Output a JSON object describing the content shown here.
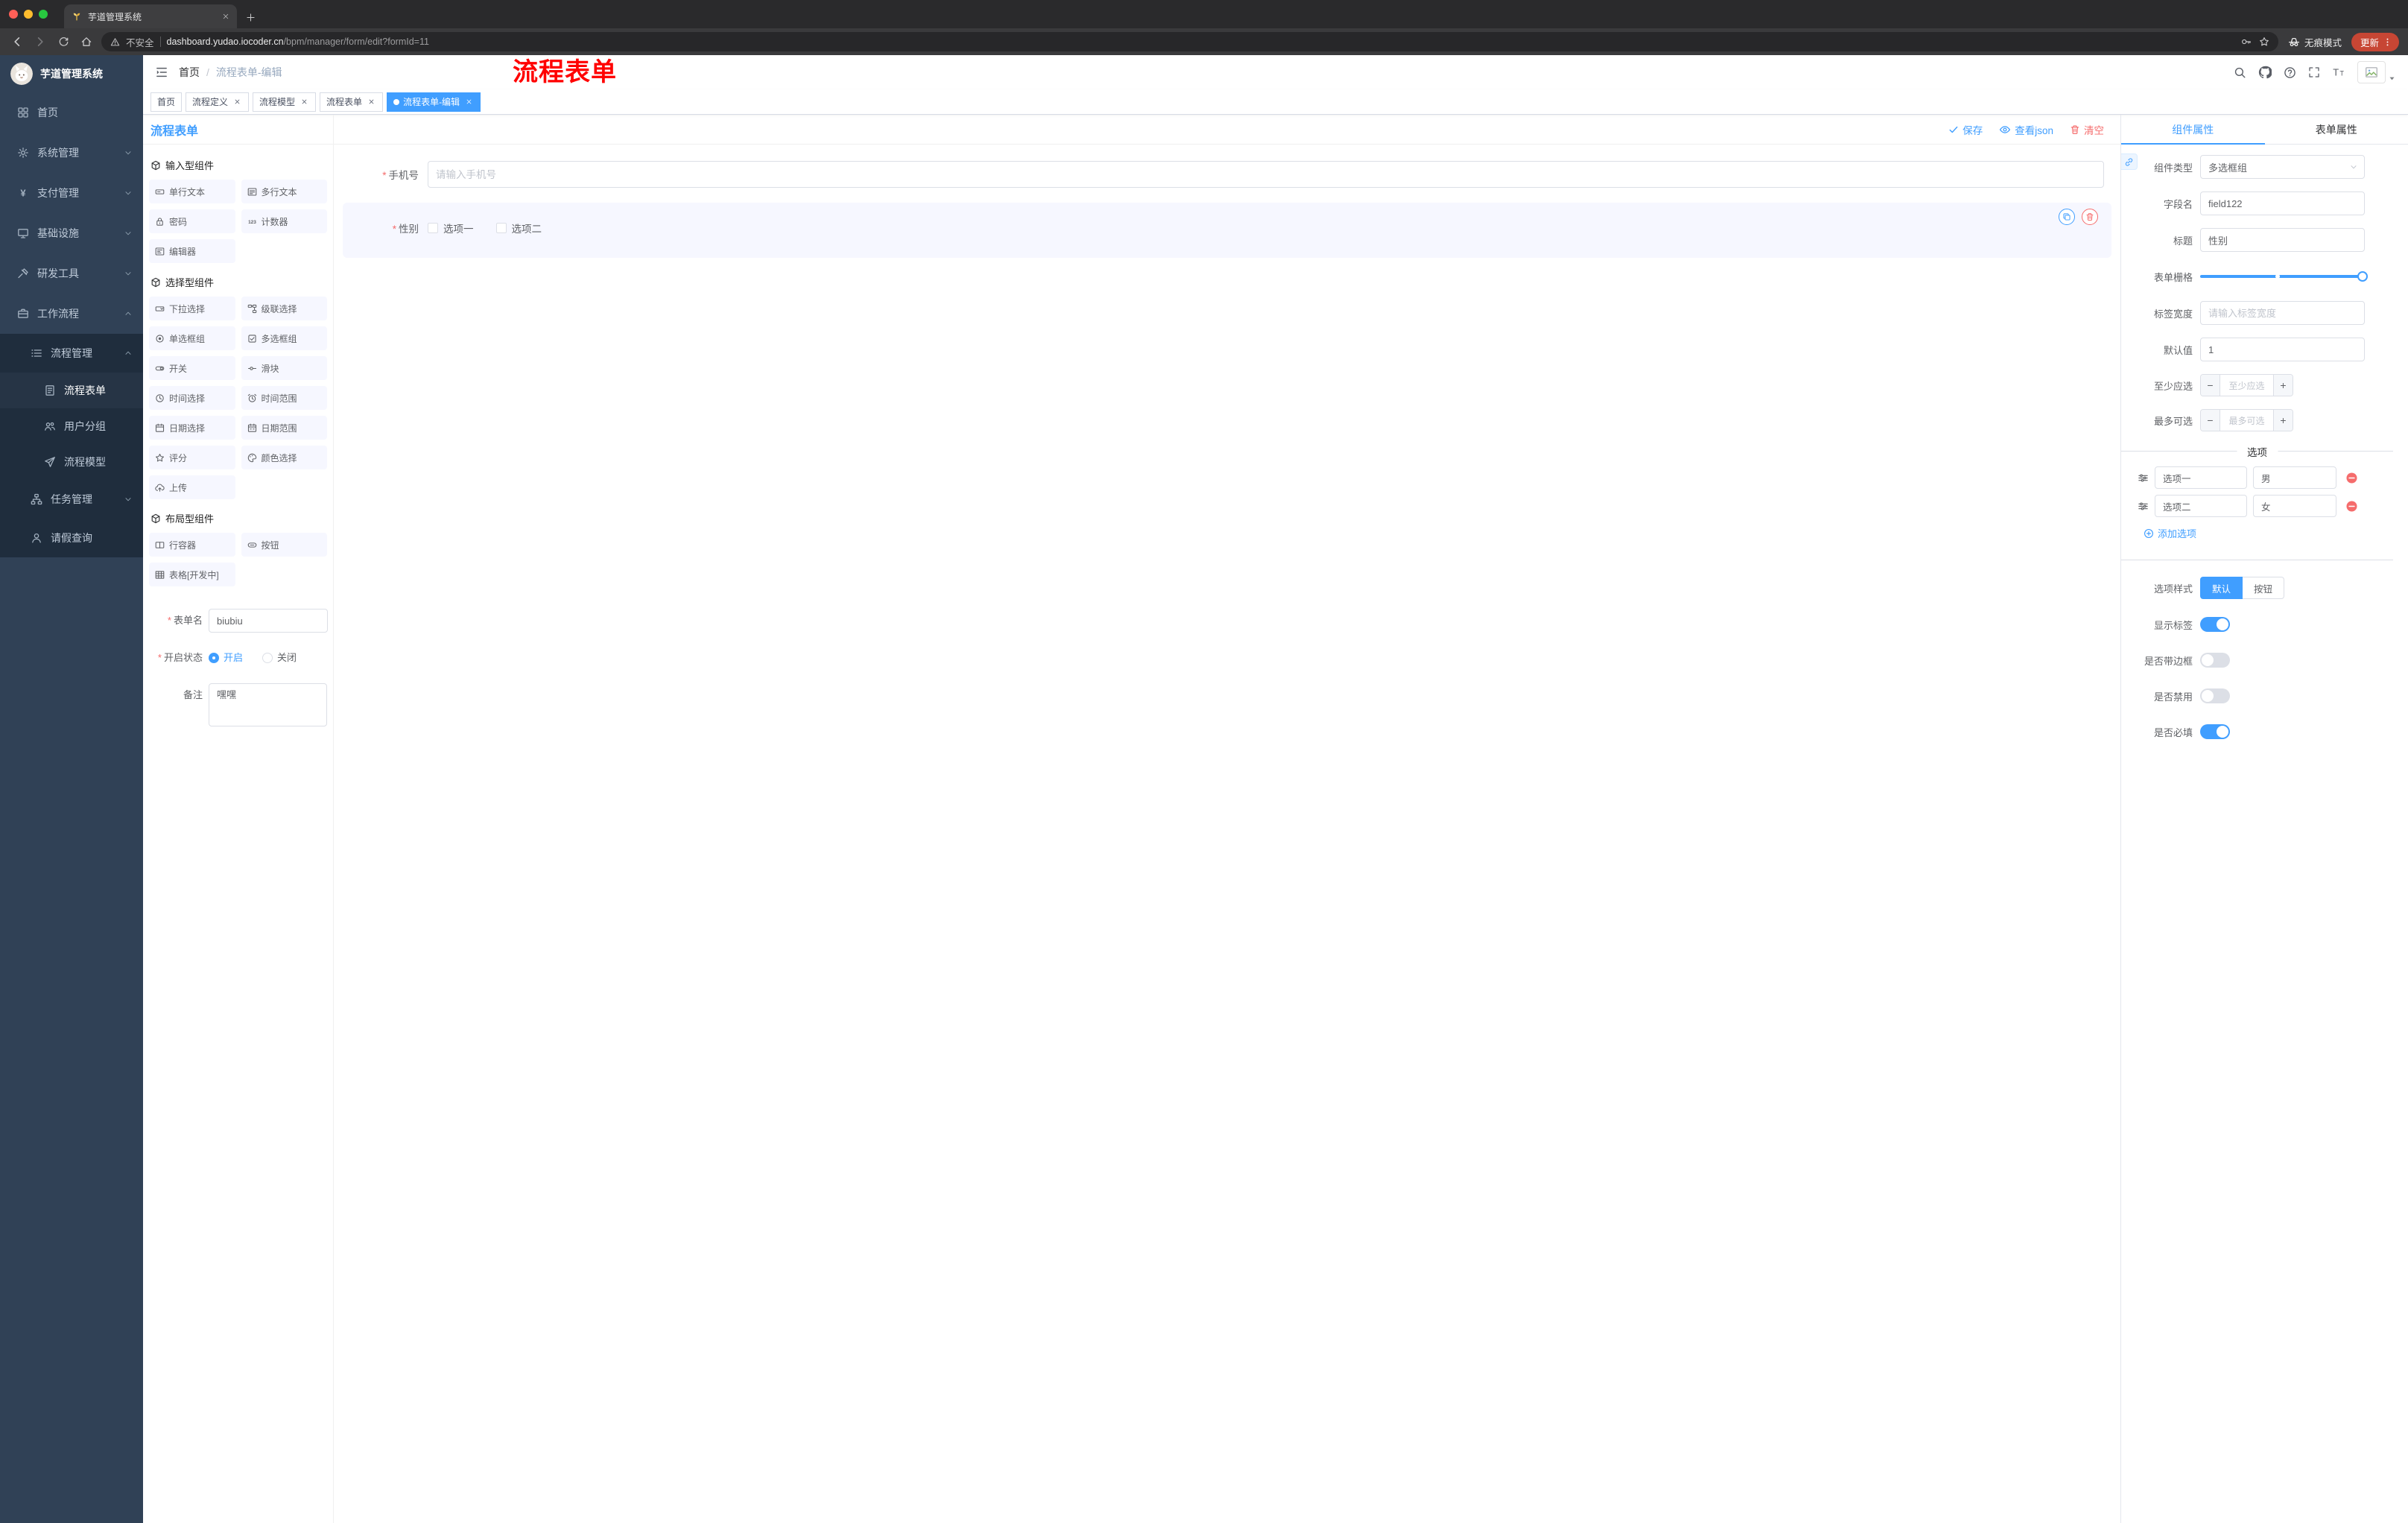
{
  "browser": {
    "tab": {
      "title": "芋道管理系统"
    },
    "address": {
      "security_label": "不安全",
      "host": "dashboard.yudao.iocoder.cn",
      "path": "/bpm/manager/form/edit?formId=11"
    },
    "incognito_label": "无痕模式",
    "update_label": "更新"
  },
  "sidebar": {
    "app_title": "芋道管理系统",
    "menu": [
      {
        "id": "home",
        "label": "首页",
        "icon": "home-icon"
      },
      {
        "id": "system",
        "label": "系统管理",
        "icon": "gear-icon",
        "chevron": "down"
      },
      {
        "id": "payment",
        "label": "支付管理",
        "icon": "yen-icon",
        "chevron": "down"
      },
      {
        "id": "infrastructure",
        "label": "基础设施",
        "icon": "infra-icon",
        "chevron": "down"
      },
      {
        "id": "devtools",
        "label": "研发工具",
        "icon": "tools-icon",
        "chevron": "down"
      },
      {
        "id": "workflow",
        "label": "工作流程",
        "icon": "workflow-icon",
        "chevron": "up",
        "expanded": true,
        "children": [
          {
            "id": "process-manage",
            "label": "流程管理",
            "icon": "list-icon",
            "chevron": "up",
            "expanded": true,
            "children": [
              {
                "id": "process-form",
                "label": "流程表单",
                "icon": "form-icon",
                "active": true
              },
              {
                "id": "user-group",
                "label": "用户分组",
                "icon": "user-group-icon"
              },
              {
                "id": "process-model",
                "label": "流程模型",
                "icon": "send-icon"
              }
            ]
          },
          {
            "id": "task-manage",
            "label": "任务管理",
            "icon": "tree-icon",
            "chevron": "down"
          },
          {
            "id": "leave-query",
            "label": "请假查询",
            "icon": "person-icon"
          }
        ]
      }
    ]
  },
  "header": {
    "breadcrumb": {
      "root": "首页",
      "separator": "/",
      "current": "流程表单-编辑"
    },
    "annotation": "流程表单"
  },
  "tags": [
    {
      "id": "home",
      "label": "首页",
      "closable": false,
      "active": false
    },
    {
      "id": "process-definition",
      "label": "流程定义",
      "closable": true,
      "active": false
    },
    {
      "id": "process-model",
      "label": "流程模型",
      "closable": true,
      "active": false
    },
    {
      "id": "process-form",
      "label": "流程表单",
      "closable": true,
      "active": false
    },
    {
      "id": "process-form-edit",
      "label": "流程表单-编辑",
      "closable": true,
      "active": true
    }
  ],
  "designer": {
    "panel_title": "流程表单",
    "toolbar": {
      "save": "保存",
      "view_json": "查看json",
      "clear": "清空"
    },
    "palette": [
      {
        "group": "输入型组件",
        "items": [
          {
            "id": "single-text",
            "label": "单行文本",
            "icon": "single-text-icon"
          },
          {
            "id": "multi-text",
            "label": "多行文本",
            "icon": "multi-text-icon"
          },
          {
            "id": "password",
            "label": "密码",
            "icon": "lock-icon"
          },
          {
            "id": "counter",
            "label": "计数器",
            "icon": "counter-icon"
          },
          {
            "id": "editor",
            "label": "编辑器",
            "icon": "editor-icon"
          }
        ]
      },
      {
        "group": "选择型组件",
        "items": [
          {
            "id": "select",
            "label": "下拉选择",
            "icon": "select-icon"
          },
          {
            "id": "cascader",
            "label": "级联选择",
            "icon": "cascader-icon"
          },
          {
            "id": "radio-group",
            "label": "单选框组",
            "icon": "radio-icon"
          },
          {
            "id": "checkbox-group",
            "label": "多选框组",
            "icon": "checkbox-icon"
          },
          {
            "id": "switch",
            "label": "开关",
            "icon": "switch-icon"
          },
          {
            "id": "slider",
            "label": "滑块",
            "icon": "slider-icon"
          },
          {
            "id": "time-picker",
            "label": "时间选择",
            "icon": "time-icon"
          },
          {
            "id": "time-range",
            "label": "时间范围",
            "icon": "time-range-icon"
          },
          {
            "id": "date-picker",
            "label": "日期选择",
            "icon": "date-icon"
          },
          {
            "id": "date-range",
            "label": "日期范围",
            "icon": "date-range-icon"
          },
          {
            "id": "rate",
            "label": "评分",
            "icon": "star-icon"
          },
          {
            "id": "color-picker",
            "label": "颜色选择",
            "icon": "color-icon"
          },
          {
            "id": "upload",
            "label": "上传",
            "icon": "upload-icon"
          }
        ]
      },
      {
        "group": "布局型组件",
        "items": [
          {
            "id": "row-container",
            "label": "行容器",
            "icon": "row-icon"
          },
          {
            "id": "button",
            "label": "按钮",
            "icon": "button-icon"
          },
          {
            "id": "table",
            "label": "表格[开发中]",
            "icon": "table-icon"
          }
        ]
      }
    ],
    "meta": {
      "name_label": "表单名",
      "name_value": "biubiu",
      "status_label": "开启状态",
      "status_options": [
        {
          "id": "on",
          "label": "开启",
          "selected": true
        },
        {
          "id": "off",
          "label": "关闭",
          "selected": false
        }
      ],
      "remark_label": "备注",
      "remark_value": "嘿嘿"
    },
    "canvas": {
      "phone_label": "手机号",
      "phone_placeholder": "请输入手机号",
      "gender_label": "性别",
      "gender_options": [
        "选项一",
        "选项二"
      ]
    }
  },
  "properties": {
    "tab_component": "组件属性",
    "tab_form": "表单属性",
    "component_type_label": "组件类型",
    "component_type_value": "多选框组",
    "field_name_label": "字段名",
    "field_name_value": "field122",
    "title_label": "标题",
    "title_value": "性别",
    "grid_label": "表单栅格",
    "label_width_label": "标签宽度",
    "label_width_placeholder": "请输入标签宽度",
    "default_label": "默认值",
    "default_value": "1",
    "min_label": "至少应选",
    "min_placeholder": "至少应选",
    "max_label": "最多可选",
    "max_placeholder": "最多可选",
    "options_divider": "选项",
    "options": [
      {
        "label": "选项一",
        "value": "男"
      },
      {
        "label": "选项二",
        "value": "女"
      }
    ],
    "add_option_label": "添加选项",
    "option_style_label": "选项样式",
    "option_styles": [
      {
        "id": "default",
        "label": "默认",
        "selected": true
      },
      {
        "id": "button",
        "label": "按钮",
        "selected": false
      }
    ],
    "switches": [
      {
        "id": "show-label",
        "label": "显示标签",
        "on": true
      },
      {
        "id": "with-border",
        "label": "是否带边框",
        "on": false
      },
      {
        "id": "disabled",
        "label": "是否禁用",
        "on": false
      },
      {
        "id": "required",
        "label": "是否必填",
        "on": true
      }
    ]
  },
  "colors": {
    "accent": "#409eff",
    "danger": "#f56c6c",
    "annotation": "#ff0000",
    "sidebar_bg": "#304156",
    "sidebar_submenu_bg": "#1f2d3d",
    "update_pill": "#c74634",
    "selected_item_bg": "#f6f7ff"
  }
}
